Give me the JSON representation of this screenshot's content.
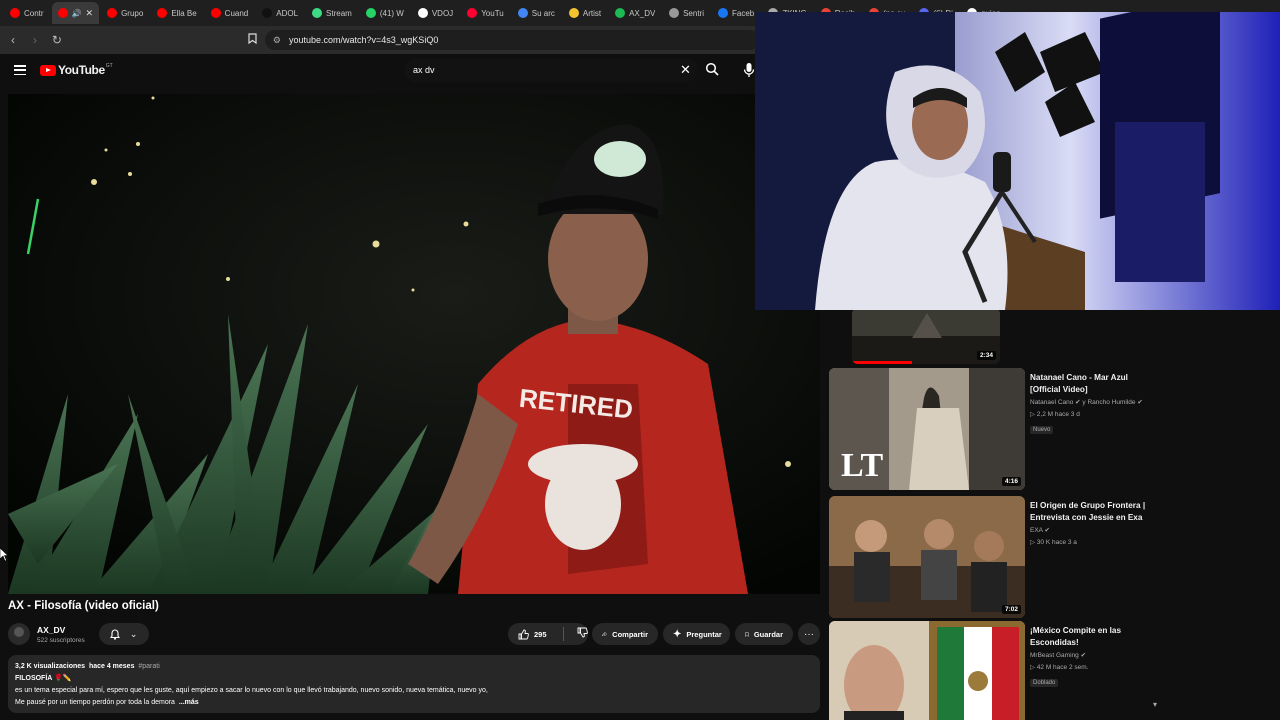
{
  "browser": {
    "tabs": [
      {
        "label": "Contr",
        "color": "#ff0000"
      },
      {
        "label": "",
        "color": "#ff0000",
        "active": true
      },
      {
        "label": "Grupo",
        "color": "#ff0000"
      },
      {
        "label": "Ella Be",
        "color": "#ff0000"
      },
      {
        "label": "Cuand",
        "color": "#ff0000"
      },
      {
        "label": "ADOL",
        "color": "#111111"
      },
      {
        "label": "Stream",
        "color": "#3ddc84"
      },
      {
        "label": "(41) W",
        "color": "#25d366"
      },
      {
        "label": "VDOJ",
        "color": "#ffffff"
      },
      {
        "label": "YouTu",
        "color": "#ff0033"
      },
      {
        "label": "Su arc",
        "color": "#4285f4"
      },
      {
        "label": "Artist",
        "color": "#f4c430"
      },
      {
        "label": "AX_DV",
        "color": "#1db954"
      },
      {
        "label": "Sentri",
        "color": "#999999"
      },
      {
        "label": "Faceb",
        "color": "#1877f2"
      },
      {
        "label": "ZKING",
        "color": "#aaaaaa"
      },
      {
        "label": "Recib",
        "color": "#ea4335"
      },
      {
        "label": "(no su",
        "color": "#ea4335"
      },
      {
        "label": "(6) Di",
        "color": "#5865f2"
      },
      {
        "label": "quien",
        "color": "#ffffff"
      }
    ],
    "url": "youtube.com/watch?v=4s3_wgKSiQ0"
  },
  "youtube": {
    "logo_text": "YouTube",
    "country_code": "GT",
    "search_query": "ax dv"
  },
  "video": {
    "title": "AX - Filosofía (video oficial)",
    "channel": "AX_DV",
    "subscribers": "522 suscriptores",
    "likes": "295",
    "share_label": "Compartir",
    "ask_label": "Preguntar",
    "save_label": "Guardar",
    "views": "3,2 K visualizaciones",
    "age": "hace 4 meses",
    "hashtag": "#parati",
    "desc_line1": "FILOSOFÍA 🌹✏️",
    "desc_line2": "es un tema especial para mí, espero que les guste, aquí empiezo a sacar lo nuevo con lo que llevó trabajando, nuevo sonido, nueva temática, nuevo yo,",
    "desc_line3": "Me pausé por un tiempo perdón por toda la demora",
    "more_label": "...más"
  },
  "recommendations": [
    {
      "title": "",
      "channel": "",
      "stats": "",
      "duration": "2:34",
      "badge": ""
    },
    {
      "title": "Natanael Cano - Mar Azul [Official Video]",
      "channel": "Natanael Cano ✔ y Rancho Humilde ✔",
      "stats": "▷ 2,2 M  hace 3 d",
      "duration": "4:16",
      "badge": "Nuevo"
    },
    {
      "title": "El Origen de Grupo Frontera | Entrevista con Jessie en Exa",
      "channel": "EXA ✔",
      "stats": "▷ 30 K  hace 3 a",
      "duration": "7:02",
      "badge": ""
    },
    {
      "title": "¡México Compite en las Escondidas!",
      "channel": "MrBeast Gaming ✔",
      "stats": "▷ 42 M  hace 2 sem.",
      "duration": "",
      "badge": "Doblado"
    }
  ]
}
